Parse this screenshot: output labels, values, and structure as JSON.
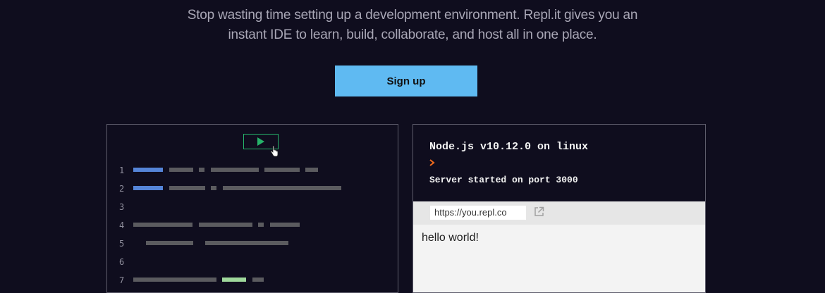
{
  "hero": {
    "tagline_line1": "Stop wasting time setting up a development environment. Repl.it gives you an",
    "tagline_line2": "instant IDE to learn, build, collaborate, and host all in one place.",
    "signup_label": "Sign up"
  },
  "editor": {
    "run_icon": "play-icon",
    "line_numbers": [
      "1",
      "2",
      "3",
      "4",
      "5",
      "6",
      "7"
    ]
  },
  "console": {
    "version_text": "Node.js v10.12.0 on linux",
    "prompt_icon": "prompt-chevron-icon",
    "output_text": "Server started on port 3000"
  },
  "browser": {
    "url": "https://you.repl.co",
    "open_icon": "external-link-icon",
    "page_text": "hello world!"
  },
  "colors": {
    "background": "#0f0d1e",
    "accent_button": "#5fbaf2",
    "run_green": "#26b36a",
    "prompt_orange": "#f26b1d",
    "code_blue": "#5585d8",
    "code_gray": "#5b5b5f",
    "code_green": "#9fd89c"
  }
}
